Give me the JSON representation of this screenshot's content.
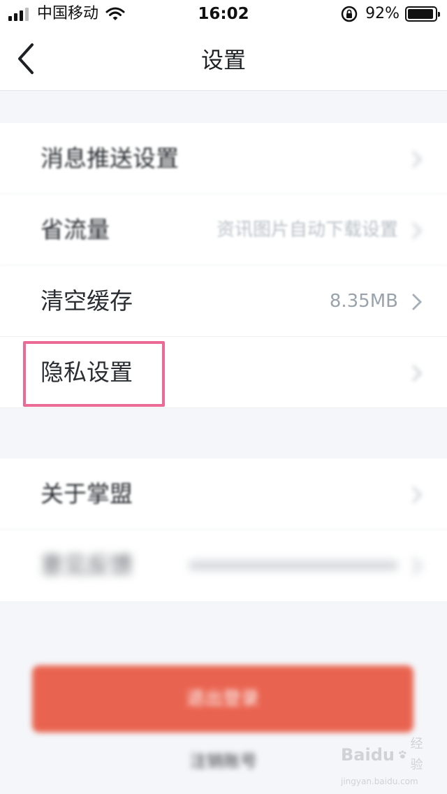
{
  "status_bar": {
    "carrier": "中国移动",
    "time": "16:02",
    "battery_percent": "92%",
    "battery_level": 0.92
  },
  "nav": {
    "title": "设置",
    "back_icon": "chevron-left-icon"
  },
  "settings": {
    "group1": [
      {
        "label": "消息推送设置",
        "value": ""
      },
      {
        "label": "省流量",
        "value": "资讯图片自动下载设置"
      },
      {
        "label": "清空缓存",
        "value": "8.35MB"
      },
      {
        "label": "隐私设置",
        "value": ""
      }
    ],
    "group2": [
      {
        "label": "关于掌盟",
        "value": ""
      },
      {
        "label": "意见反馈",
        "value": ""
      }
    ]
  },
  "actions": {
    "logout_label": "退出登录",
    "cancel_account_label": "注销账号"
  },
  "highlight": {
    "target": "隐私设置",
    "color": "#ec6a96"
  },
  "watermark": {
    "brand": "Baidu",
    "cn": "经验",
    "url": "jingyan.baidu.com"
  },
  "colors": {
    "accent_red": "#e96450",
    "background": "#f4f6f9"
  }
}
